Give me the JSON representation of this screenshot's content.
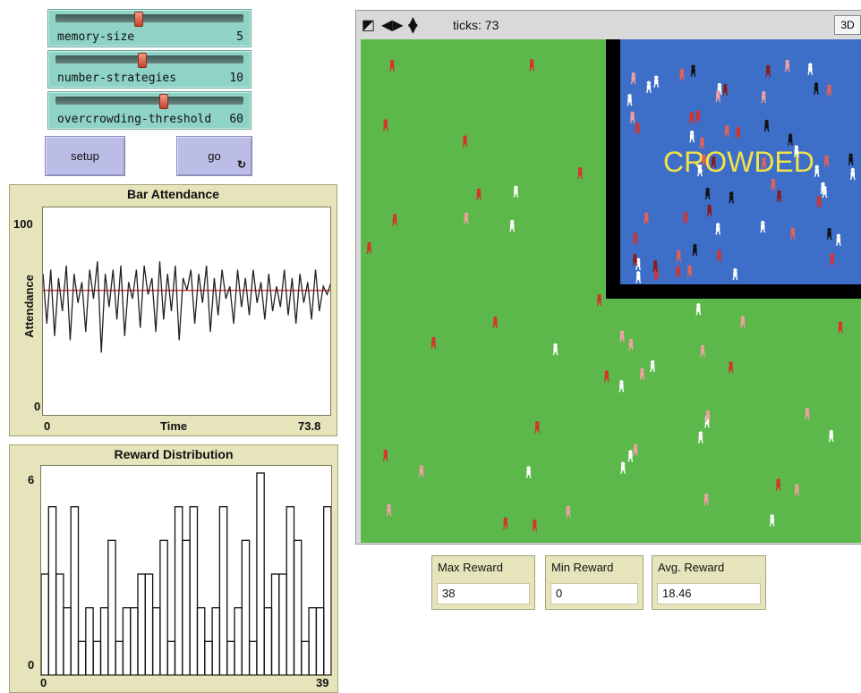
{
  "sliders": [
    {
      "label": "memory-size",
      "value": "5",
      "fraction": 0.47
    },
    {
      "label": "number-strategies",
      "value": "10",
      "fraction": 0.49
    },
    {
      "label": "overcrowding-threshold",
      "value": "60",
      "fraction": 0.6
    }
  ],
  "buttons": {
    "setup": "setup",
    "go": "go",
    "forever_icon": "forever-icon"
  },
  "attendance_plot": {
    "chart_data": {
      "type": "line",
      "title": "Bar Attendance",
      "xlabel": "Time",
      "ylabel": "Attendance",
      "xlim": [
        0,
        73.8
      ],
      "ylim": [
        0,
        100
      ],
      "x_ticks": [
        "0",
        "73.8"
      ],
      "y_ticks": [
        "100",
        "0"
      ],
      "threshold_line": {
        "y": 60,
        "color": "#e04040"
      },
      "series": [
        {
          "color": "#222222",
          "values": [
            68,
            44,
            70,
            38,
            66,
            50,
            72,
            36,
            68,
            54,
            64,
            40,
            70,
            56,
            74,
            30,
            68,
            52,
            70,
            46,
            72,
            38,
            64,
            56,
            70,
            42,
            72,
            58,
            66,
            40,
            74,
            46,
            68,
            50,
            72,
            36,
            66,
            60,
            70,
            44,
            68,
            54,
            72,
            40,
            66,
            48,
            70,
            56,
            62,
            44,
            70,
            52,
            66,
            48,
            70,
            54,
            64,
            46,
            68,
            50,
            62,
            52,
            70,
            48,
            66,
            44,
            68,
            54,
            64,
            46,
            70,
            50,
            62,
            58,
            64
          ]
        }
      ]
    }
  },
  "reward_plot": {
    "chart_data": {
      "type": "bar",
      "title": "Reward Distribution",
      "xlim": [
        0,
        39
      ],
      "ylim": [
        0,
        6
      ],
      "x_ticks": [
        "0",
        "39"
      ],
      "y_ticks": [
        "6",
        "0"
      ],
      "values": [
        3,
        5,
        3,
        2,
        5,
        1,
        2,
        1,
        2,
        4,
        1,
        2,
        2,
        3,
        3,
        2,
        4,
        1,
        5,
        4,
        5,
        2,
        1,
        2,
        5,
        1,
        2,
        4,
        1,
        6,
        2,
        3,
        3,
        5,
        4,
        1,
        2,
        2,
        5
      ]
    }
  },
  "view": {
    "ticks_label": "ticks: 73",
    "threed_label": "3D",
    "crowded_label": "CROWDED",
    "colors": {
      "world": "#5cb84a",
      "bar": "#3d6fc8",
      "border": "#000000",
      "crowded_text": "#f2e14a"
    }
  },
  "monitors": [
    {
      "label": "Max Reward",
      "value": "38"
    },
    {
      "label": "Min Reward",
      "value": "0"
    },
    {
      "label": "Avg. Reward",
      "value": "18.46"
    }
  ]
}
